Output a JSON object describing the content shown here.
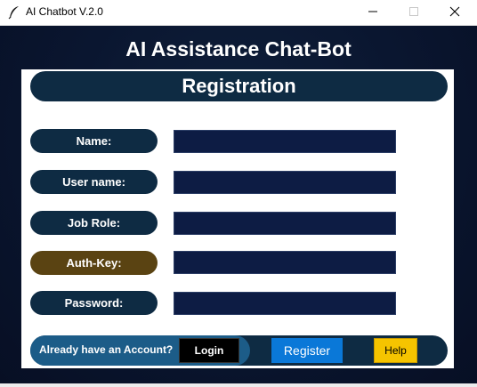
{
  "window": {
    "title": "AI Chatbot V.2.0",
    "icon": "feather-icon",
    "controls": {
      "minimize": "minimize-icon",
      "maximize": "maximize-icon",
      "close": "close-icon"
    }
  },
  "app": {
    "heading": "AI Assistance Chat-Bot"
  },
  "form": {
    "header": "Registration",
    "fields": [
      {
        "label": "Name:",
        "value": ""
      },
      {
        "label": "User name:",
        "value": ""
      },
      {
        "label": "Job Role:",
        "value": ""
      },
      {
        "label": "Auth-Key:",
        "value": ""
      },
      {
        "label": "Password:",
        "value": ""
      }
    ]
  },
  "footer": {
    "account_prompt": "Already have an Account?",
    "login_label": "Login",
    "register_label": "Register",
    "help_label": "Help"
  },
  "colors": {
    "background": "#0a1630",
    "pill": "#0e2b43",
    "auth_pill": "#5a4312",
    "input": "#0d1c44",
    "register": "#0a78d8",
    "help": "#f5c400",
    "login": "#000000"
  }
}
